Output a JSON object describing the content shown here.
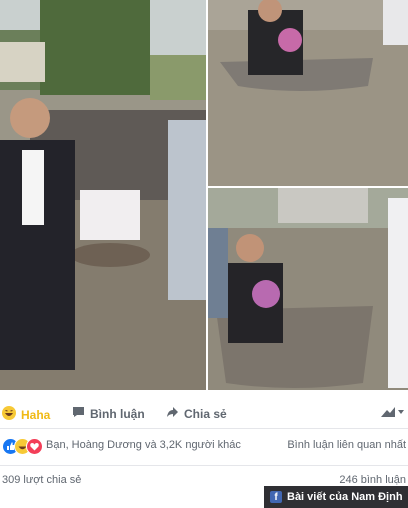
{
  "actions": {
    "haha_label": "Haha",
    "comment_label": "Bình luận",
    "share_label": "Chia sẻ",
    "haha_icon": "haha-emoji-icon",
    "comment_icon": "speech-bubble-icon",
    "share_icon": "share-arrow-icon",
    "viewer_icon": "profile-dropdown-icon"
  },
  "reactions": {
    "summary": "Bạn, Hoàng Dương và 3,2K người khác",
    "related_label": "Bình luận liên quan nhất",
    "icons": [
      "like-icon",
      "haha-icon",
      "love-icon"
    ]
  },
  "stats": {
    "shares": "309 lượt chia sẻ",
    "comments": "246 bình luận"
  },
  "footer": {
    "page_label": "Bài viết của Nam Định"
  },
  "colors": {
    "haha": "#f0ba15",
    "like": "#1877f2",
    "love": "#f33e58",
    "floodwater": "#8b8577"
  }
}
